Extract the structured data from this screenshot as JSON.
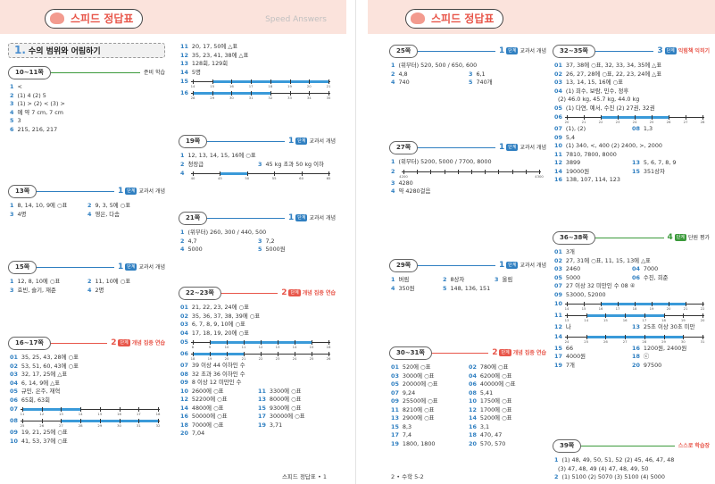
{
  "left": {
    "title": "스피드 정답표",
    "subtitle_en": "Speed Answers",
    "section": {
      "num": "1.",
      "label": "수의 범위와 어림하기"
    },
    "footer": "스피드 정답표 • 1",
    "boxes": {
      "b1011": {
        "page": "10~11쪽",
        "tag": "준비 학습",
        "lines": [
          {
            "n": "1",
            "t": "<"
          },
          {
            "n": "2",
            "t": "(1) 4  (2) 5"
          },
          {
            "n": "3",
            "t": "(1) >   (2) <   (3) >"
          },
          {
            "n": "4",
            "t": "예 약 7 cm, 7 cm"
          },
          {
            "n": "5",
            "t": "3"
          },
          {
            "n": "6",
            "t": "215, 216, 217"
          }
        ]
      },
      "b13": {
        "page": "13쪽",
        "level": "1",
        "badge": "단계",
        "tag": "교과서 개념",
        "lines": [
          {
            "n": "1",
            "t": "8, 14, 10, 9에 ○표"
          },
          {
            "n": "2",
            "t": "9, 3, 5에 ○표"
          },
          {
            "n": "3",
            "t": "4명"
          },
          {
            "n": "4",
            "t": "영은, 다솜"
          }
        ]
      },
      "b15": {
        "page": "15쪽",
        "level": "1",
        "badge": "단계",
        "tag": "교과서 개념",
        "lines": [
          {
            "n": "1",
            "t": "12, 8, 10에 ○표"
          },
          {
            "n": "2",
            "t": "11, 10에 ○표"
          },
          {
            "n": "3",
            "t": "효빈, 슬기, 재준"
          },
          {
            "n": "4",
            "t": "2명"
          }
        ]
      },
      "b1617": {
        "page": "16~17쪽",
        "level": "2",
        "badge": "단계",
        "tag": "개념 집중 연습",
        "lines": [
          {
            "n": "01",
            "t": "35, 25, 43, 28에 ○표"
          },
          {
            "n": "02",
            "t": "53, 51, 60, 43에 ○표"
          },
          {
            "n": "03",
            "t": "32, 17, 25에 △표"
          },
          {
            "n": "04",
            "t": "6, 14, 9에 △표"
          },
          {
            "n": "05",
            "t": "규민, 은주, 재혁"
          },
          {
            "n": "06",
            "t": "65회, 63회"
          }
        ],
        "nl07": {
          "n": "07",
          "ticks": [
            "11",
            "12",
            "13",
            "14",
            "15",
            "16",
            "17",
            "18"
          ]
        },
        "nl08": {
          "n": "08",
          "ticks": [
            "25",
            "26",
            "27",
            "28",
            "29",
            "30",
            "31",
            "32"
          ]
        },
        "lines2": [
          {
            "n": "09",
            "t": "19, 21, 25에 ○표"
          },
          {
            "n": "10",
            "t": "41, 53, 37에 ○표"
          }
        ]
      },
      "bcont": {
        "lines": [
          {
            "n": "11",
            "t": "20, 17, 50에 △표"
          },
          {
            "n": "12",
            "t": "35, 23, 41, 38에 △표"
          },
          {
            "n": "13",
            "t": "128회, 129회"
          },
          {
            "n": "14",
            "t": "5명"
          }
        ],
        "nl15": {
          "n": "15",
          "ticks": [
            "14",
            "15",
            "16",
            "17",
            "18",
            "19",
            "20",
            "21"
          ]
        },
        "nl16": {
          "n": "16",
          "ticks": [
            "28",
            "29",
            "30",
            "31",
            "32",
            "33",
            "34",
            "35"
          ]
        }
      },
      "b19": {
        "page": "19쪽",
        "level": "1",
        "badge": "단계",
        "tag": "교과서 개념",
        "lines": [
          {
            "n": "1",
            "t": "12, 13, 14, 15, 16에 ○표"
          }
        ],
        "pair": [
          {
            "n": "2",
            "t": "청장급"
          },
          {
            "n": "3",
            "t": "45 kg 초과 50 kg 이하"
          }
        ],
        "nl4": {
          "n": "4",
          "ticks": [
            "40",
            "45",
            "50",
            "55",
            "60",
            "65"
          ]
        }
      },
      "b21": {
        "page": "21쪽",
        "level": "1",
        "badge": "단계",
        "tag": "교과서 개념",
        "lines": [
          {
            "n": "1",
            "t": "(위부터) 260, 300 / 440, 500"
          }
        ],
        "grid": [
          {
            "n": "2",
            "t": "4,7"
          },
          {
            "n": "3",
            "t": "7,2"
          },
          {
            "n": "4",
            "t": "5000"
          },
          {
            "n": "5",
            "t": "5000원"
          }
        ]
      },
      "b2223": {
        "page": "22~23쪽",
        "level": "2",
        "badge": "단계",
        "tag": "개념 집중 연습",
        "lines": [
          {
            "n": "01",
            "t": "21, 22, 23, 24에 ○표"
          },
          {
            "n": "02",
            "t": "35, 36, 37, 38, 39에 ○표"
          },
          {
            "n": "03",
            "t": "6, 7, 8, 9, 10에 ○표"
          },
          {
            "n": "04",
            "t": "17, 18, 19, 20에 ○표"
          }
        ],
        "nl05": {
          "n": "05",
          "ticks": [
            "8",
            "9",
            "10",
            "11",
            "12",
            "13",
            "14",
            "15",
            "16"
          ]
        },
        "nl06": {
          "n": "06",
          "ticks": [
            "18",
            "19",
            "20",
            "21",
            "22",
            "23",
            "24",
            "25",
            "26"
          ]
        },
        "lines2": [
          {
            "n": "07",
            "t": "39 이상 44 이하인 수"
          },
          {
            "n": "08",
            "t": "32 초과 36 이하인 수"
          },
          {
            "n": "09",
            "t": "8 이상 12 미만인 수"
          }
        ],
        "grid": [
          {
            "n": "10",
            "t": "2600에 ○표"
          },
          {
            "n": "11",
            "t": "3300에 ○표"
          },
          {
            "n": "12",
            "t": "52200에 ○표"
          },
          {
            "n": "13",
            "t": "8000에 ○표"
          },
          {
            "n": "14",
            "t": "4800에 ○표"
          },
          {
            "n": "15",
            "t": "9300에 ○표"
          },
          {
            "n": "16",
            "t": "50000에 ○표"
          },
          {
            "n": "17",
            "t": "30000에 ○표"
          },
          {
            "n": "18",
            "t": "7000에 ○표"
          },
          {
            "n": "19",
            "t": "3,71"
          },
          {
            "n": "20",
            "t": "7,04"
          },
          {
            "n": "",
            "t": ""
          }
        ]
      }
    }
  },
  "right": {
    "title": "스피드 정답표",
    "footer": "2 • 수학 5-2",
    "boxes": {
      "b25": {
        "page": "25쪽",
        "level": "1",
        "badge": "단계",
        "tag": "교과서 개념",
        "lines": [
          {
            "n": "1",
            "t": "(위부터) 520, 500 / 650, 600"
          }
        ],
        "grid": [
          {
            "n": "2",
            "t": "4,8"
          },
          {
            "n": "3",
            "t": "6,1"
          },
          {
            "n": "4",
            "t": "740"
          },
          {
            "n": "5",
            "t": "740개"
          }
        ]
      },
      "b27": {
        "page": "27쪽",
        "level": "1",
        "badge": "단계",
        "tag": "교과서 개념",
        "lines": [
          {
            "n": "1",
            "t": "(위부터) 5200, 5000 / 7700, 8000"
          }
        ],
        "nl2": {
          "n": "2",
          "ticks": [
            "4200",
            "",
            "",
            "",
            "",
            "",
            "",
            "",
            "",
            "",
            "4300"
          ]
        },
        "lines2": [
          {
            "n": "3",
            "t": "4280"
          },
          {
            "n": "4",
            "t": "약 4280걸음"
          }
        ]
      },
      "b29": {
        "page": "29쪽",
        "level": "1",
        "badge": "단계",
        "tag": "교과서 개념",
        "grid3": [
          {
            "n": "1",
            "t": "버림"
          },
          {
            "n": "2",
            "t": "8상자"
          },
          {
            "n": "3",
            "t": "올림"
          }
        ],
        "pair": [
          {
            "n": "4",
            "t": "350원"
          },
          {
            "n": "5",
            "t": "148, 136, 151"
          }
        ]
      },
      "b3031": {
        "page": "30~31쪽",
        "level": "2",
        "badge": "단계",
        "tag": "개념 집중 연습",
        "grid": [
          {
            "n": "01",
            "t": "520에 ○표"
          },
          {
            "n": "02",
            "t": "780에 ○표"
          },
          {
            "n": "03",
            "t": "3000에 ○표"
          },
          {
            "n": "04",
            "t": "6200에 ○표"
          },
          {
            "n": "05",
            "t": "20000에 ○표"
          },
          {
            "n": "06",
            "t": "40000에 ○표"
          },
          {
            "n": "07",
            "t": "9,24"
          },
          {
            "n": "08",
            "t": "5,41"
          },
          {
            "n": "09",
            "t": "25500에 ○표"
          },
          {
            "n": "10",
            "t": "1750에 ○표"
          },
          {
            "n": "11",
            "t": "8210에 ○표"
          },
          {
            "n": "12",
            "t": "1700에 ○표"
          },
          {
            "n": "13",
            "t": "2900에 ○표"
          },
          {
            "n": "14",
            "t": "5200에 ○표"
          },
          {
            "n": "15",
            "t": "8,3"
          },
          {
            "n": "16",
            "t": "3,1"
          },
          {
            "n": "17",
            "t": "7,4"
          },
          {
            "n": "18",
            "t": "470, 47"
          },
          {
            "n": "19",
            "t": "1800, 1800"
          },
          {
            "n": "20",
            "t": "570, 570"
          }
        ]
      },
      "b3235": {
        "page": "32~35쪽",
        "level": "3",
        "badge": "단계",
        "tag": "익힘책 익히기",
        "lines": [
          {
            "n": "01",
            "t": "37, 38에 ○표, 32, 33, 34, 35에 △표"
          },
          {
            "n": "02",
            "t": "26, 27, 28에 ○표, 22, 23, 24에 △표"
          },
          {
            "n": "03",
            "t": "13, 14, 15, 16에 ○표"
          },
          {
            "n": "04",
            "t": "(1) 희수, 보람, 민수, 정후"
          },
          {
            "n": "",
            "t": "(2) 46.0 kg, 45.7 kg, 44.0 kg"
          },
          {
            "n": "05",
            "t": "(1) 다연, 예서, 수진  (2) 27권, 32권"
          }
        ],
        "nl06": {
          "n": "06",
          "ticks": [
            "20",
            "21",
            "22",
            "23",
            "24",
            "25",
            "26",
            "27",
            "28"
          ]
        },
        "grid": [
          {
            "n": "07",
            "t": "(1), (2)"
          },
          {
            "n": "08",
            "t": "1,3"
          }
        ],
        "lines2": [
          {
            "n": "09",
            "t": "5,4"
          },
          {
            "n": "10",
            "t": "(1) 340, <, 400  (2) 2400, >, 2000"
          },
          {
            "n": "11",
            "t": "7810, 7800, 8000"
          }
        ],
        "grid2": [
          {
            "n": "12",
            "t": "3899"
          },
          {
            "n": "13",
            "t": "5, 6, 7, 8, 9"
          },
          {
            "n": "14",
            "t": "19000원"
          },
          {
            "n": "15",
            "t": "351상자"
          }
        ],
        "lines3": [
          {
            "n": "16",
            "t": "138, 107, 114, 123"
          }
        ]
      },
      "b3638": {
        "page": "36~38쪽",
        "level": "4",
        "badge": "단계",
        "tag": "단원 평가",
        "lines": [
          {
            "n": "01",
            "t": "3개"
          },
          {
            "n": "02",
            "t": "27, 31에 ○표, 11, 15, 13에 △표"
          }
        ],
        "grid": [
          {
            "n": "03",
            "t": "2460"
          },
          {
            "n": "04",
            "t": "7000"
          },
          {
            "n": "05",
            "t": "5000"
          },
          {
            "n": "06",
            "t": "수진, 희준"
          }
        ],
        "lines2": [
          {
            "n": "07",
            "t": "27 이상 32 미만인 수  08 ④"
          },
          {
            "n": "09",
            "t": "53000, 52000"
          }
        ],
        "nl10": {
          "n": "10",
          "ticks": [
            "14",
            "15",
            "16",
            "17",
            "18",
            "19",
            "20",
            "21",
            "22"
          ]
        },
        "nl11": {
          "n": "11",
          "ticks": [
            "13",
            "14",
            "15",
            "16",
            "17",
            "18",
            "19",
            "20"
          ]
        },
        "grid2": [
          {
            "n": "12",
            "t": "나"
          },
          {
            "n": "13",
            "t": "25초 이상 30초 미만"
          }
        ],
        "nl14": {
          "n": "14",
          "ticks": [
            "24",
            "25",
            "26",
            "27",
            "28",
            "29",
            "30",
            "31"
          ]
        },
        "grid3": [
          {
            "n": "15",
            "t": "66"
          },
          {
            "n": "16",
            "t": "1200원, 2400원"
          },
          {
            "n": "17",
            "t": "4000원"
          },
          {
            "n": "18",
            "t": "ⓒ"
          },
          {
            "n": "19",
            "t": "7개"
          },
          {
            "n": "20",
            "t": "97500"
          }
        ]
      },
      "b39": {
        "page": "39쪽",
        "tag": "스스로 학습장",
        "lines": [
          {
            "n": "1",
            "t": "(1) 48, 49, 50, 51, 52  (2) 45, 46, 47, 48"
          },
          {
            "n": "",
            "t": "(3) 47, 48, 49  (4) 47, 48, 49, 50"
          },
          {
            "n": "2",
            "t": "(1) 5100  (2) 5070  (3) 5100  (4) 5000"
          }
        ]
      }
    }
  }
}
